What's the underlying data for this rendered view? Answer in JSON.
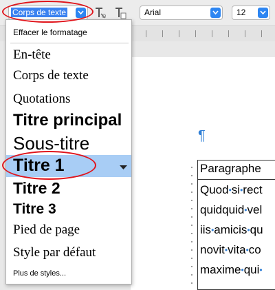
{
  "toolbar": {
    "style_value": "Corps de texte",
    "font_value": "Arial",
    "size_value": "12"
  },
  "menu": {
    "clear_formatting": "Effacer le formatage",
    "items": [
      {
        "label": "En-tête"
      },
      {
        "label": "Corps de texte"
      },
      {
        "label": "Quotations"
      },
      {
        "label": "Titre principal"
      },
      {
        "label": "Sous-titre"
      },
      {
        "label": "Titre 1"
      },
      {
        "label": "Titre 2"
      },
      {
        "label": "Titre 3"
      },
      {
        "label": "Pied de page"
      },
      {
        "label": "Style par défaut"
      }
    ],
    "more_styles": "Plus de styles..."
  },
  "document": {
    "pilcrow": "¶",
    "table_header": "Paragraphe",
    "lines": [
      [
        "Quod",
        "si",
        "rect"
      ],
      [
        "quidquid",
        "vel"
      ],
      [
        "iis",
        "amicis",
        "qu"
      ],
      [
        "novit",
        "vita",
        "co"
      ],
      [
        "maxime",
        "qui",
        ""
      ]
    ]
  },
  "colors": {
    "accent": "#2d86f2",
    "highlight_oval": "#e0151c",
    "selected_item": "#a8cdf5"
  }
}
